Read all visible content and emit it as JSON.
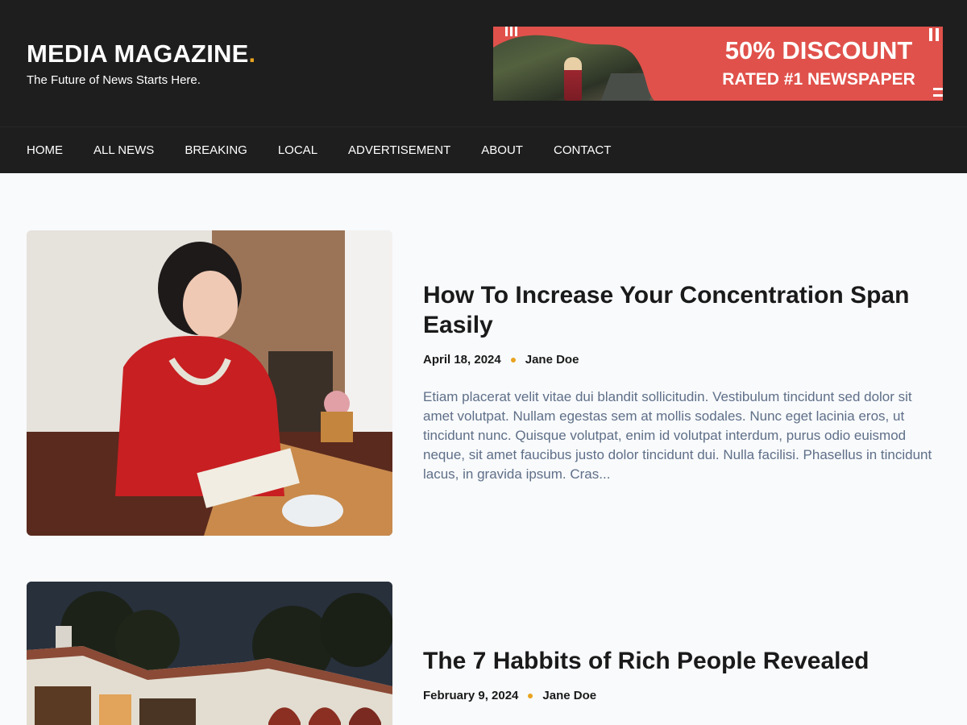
{
  "header": {
    "site_title": "MEDIA MAGAZINE",
    "title_accent": ".",
    "tagline": "The Future of News Starts Here."
  },
  "ad": {
    "line1": "50% DISCOUNT",
    "line2": "RATED #1 NEWSPAPER"
  },
  "nav": {
    "items": [
      "HOME",
      "ALL NEWS",
      "BREAKING",
      "LOCAL",
      "ADVERTISEMENT",
      "ABOUT",
      "CONTACT"
    ]
  },
  "posts": [
    {
      "title": "How To Increase Your Concentration Span Easily",
      "date": "April 18, 2024",
      "author": "Jane Doe",
      "excerpt": "Etiam placerat velit vitae dui blandit sollicitudin. Vestibulum tincidunt sed dolor sit amet volutpat. Nullam egestas sem at mollis sodales. Nunc eget lacinia eros, ut tincidunt nunc. Quisque volutpat, enim id volutpat interdum, purus odio euismod neque, sit amet faucibus justo dolor tincidunt dui. Nulla facilisi. Phasellus in tincidunt lacus, in gravida ipsum. Cras..."
    },
    {
      "title": "The 7 Habbits of Rich People Revealed",
      "date": "February 9, 2024",
      "author": "Jane Doe"
    }
  ],
  "colors": {
    "header_bg": "#1e1e1e",
    "accent": "#e8a31f",
    "ad_red": "#e0514b",
    "page_bg": "#f8fafc",
    "excerpt_text": "#5f6f88"
  }
}
